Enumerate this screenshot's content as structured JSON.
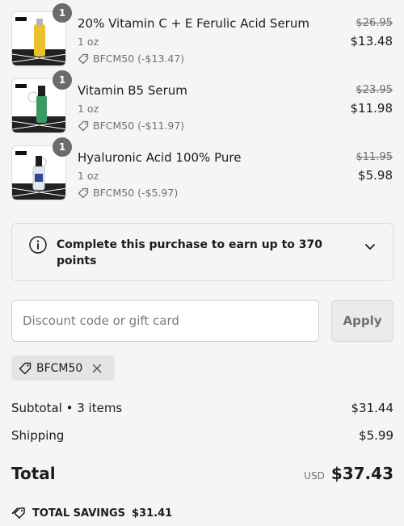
{
  "items": [
    {
      "quantity": "1",
      "name": "20% Vitamin C + E Ferulic Acid Serum",
      "size": "1 oz",
      "discount": "BFCM50 (-$13.47)",
      "original_price": "$26.95",
      "price": "$13.48",
      "bottle_color": "#e9c12a"
    },
    {
      "quantity": "1",
      "name": "Vitamin B5 Serum",
      "size": "1 oz",
      "discount": "BFCM50 (-$11.97)",
      "original_price": "$23.95",
      "price": "$11.98",
      "bottle_color": "#3c9b63"
    },
    {
      "quantity": "1",
      "name": "Hyaluronic Acid 100% Pure",
      "size": "1 oz",
      "discount": "BFCM50 (-$5.97)",
      "original_price": "$11.95",
      "price": "$5.98",
      "bottle_color": "#dfe6ee"
    }
  ],
  "points": {
    "text": "Complete this purchase to earn up to 370 points",
    "info_icon": "info-circle-icon",
    "toggle_icon": "chevron-down-icon"
  },
  "discount": {
    "placeholder": "Discount code or gift card",
    "value": "",
    "apply_label": "Apply",
    "applied_code": "BFCM50"
  },
  "summary": {
    "subtotal_label": "Subtotal • 3 items",
    "subtotal_value": "$31.44",
    "shipping_label": "Shipping",
    "shipping_value": "$5.99",
    "total_label": "Total",
    "currency": "USD",
    "total_value": "$37.43",
    "savings_label": "TOTAL SAVINGS",
    "savings_value": "$31.41"
  },
  "colors": {
    "background": "#f5f5f5",
    "text": "#1c1c1c",
    "muted": "#707070",
    "badge": "#6b6b6b"
  }
}
